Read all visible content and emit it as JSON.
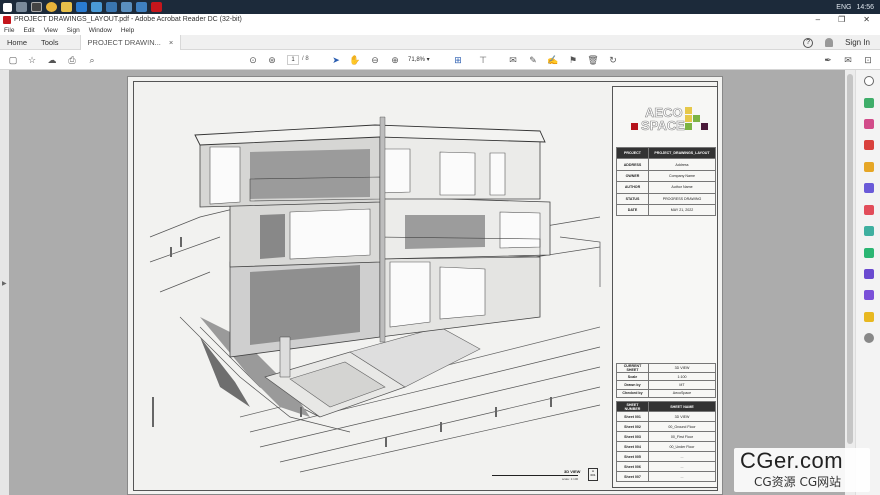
{
  "taskbar": {
    "clock": "14:56",
    "lang": "ENG"
  },
  "window": {
    "title": "PROJECT DRAWINGS_LAYOUT.pdf - Adobe Acrobat Reader DC (32-bit)",
    "minimize": "–",
    "maximize": "❐",
    "close": "✕"
  },
  "menu": [
    "File",
    "Edit",
    "View",
    "Sign",
    "Window",
    "Help"
  ],
  "tabs": {
    "home": "Home",
    "tools": "Tools",
    "document": "PROJECT DRAWIN...",
    "close": "×",
    "signin": "Sign In",
    "help": "?"
  },
  "toolbar": {
    "page_current": "1",
    "page_total": "/ 8",
    "zoom": "71,8%"
  },
  "titleblock": {
    "logo_text_1": "AECO",
    "logo_text_2": "SPACE",
    "rows": [
      {
        "label": "PROJECT",
        "value": "PROJECT_DRAWINGS_LAYOUT"
      },
      {
        "label": "ADDRESS",
        "value": "Address"
      },
      {
        "label": "OWNER",
        "value": "Company Name"
      },
      {
        "label": "AUTHOR",
        "value": "Author Name"
      },
      {
        "label": "STATUS",
        "value": "PROGRESS DRAWING"
      },
      {
        "label": "DATE",
        "value": "MAY 21, 2022"
      }
    ],
    "sheet_info": [
      {
        "label": "CURRENT SHEET",
        "value": "3D VIEW"
      },
      {
        "label": "Scale",
        "value": "1:100"
      },
      {
        "label": "Drawn by",
        "value": "MT"
      },
      {
        "label": "Checked by",
        "value": "AecoSpace"
      }
    ],
    "sheet_header": {
      "number": "SHEET NUMBER",
      "name": "SHEET NAME"
    },
    "sheets": [
      {
        "number": "Sheet 001",
        "name": "3D VIEW"
      },
      {
        "number": "Sheet 002",
        "name": "00_Ground Floor"
      },
      {
        "number": "Sheet 003",
        "name": "00_First Floor"
      },
      {
        "number": "Sheet 004",
        "name": "00_Under Floor"
      },
      {
        "number": "Sheet 005",
        "name": "..."
      },
      {
        "number": "Sheet 006",
        "name": "..."
      },
      {
        "number": "Sheet 007",
        "name": "..."
      }
    ]
  },
  "drawing_label": {
    "name": "3D VIEW",
    "scale": "scale: 1:100",
    "number": "A",
    "sheet": "001"
  },
  "watermark": {
    "line1": "CGer.com",
    "line2": "CG资源 CG网站"
  },
  "colors": {
    "accent_red": "#c4161c",
    "logo_red": "#b5121b",
    "logo_yellow": "#e6c84a",
    "logo_green": "#7cb342",
    "logo_purple": "#4a1a3a"
  }
}
